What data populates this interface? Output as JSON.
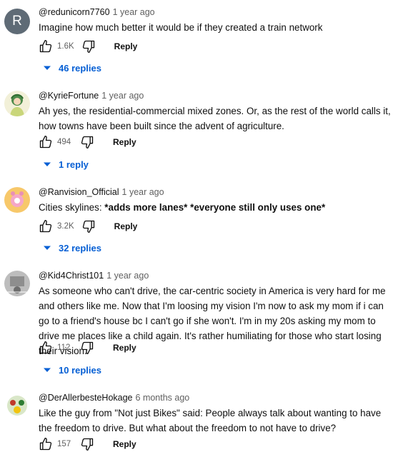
{
  "comments": [
    {
      "author": "@redunicorn7760",
      "time": "1 year ago",
      "avatar_letter": "R",
      "text": "Imagine how much better it would be if they created a train network",
      "likes": "1.6K",
      "reply_label": "Reply",
      "replies": "46 replies"
    },
    {
      "author": "@KyrieFortune",
      "time": "1 year ago",
      "text": "Ah yes, the residential-commercial mixed zones. Or, as the rest of the world calls it, how towns have been built since the advent of agriculture.",
      "likes": "494",
      "reply_label": "Reply",
      "replies": "1 reply"
    },
    {
      "author": "@Ranvision_Official",
      "time": "1 year ago",
      "text_parts": [
        "Cities skylines: ",
        "*adds more lanes*",
        " ",
        "*everyone still only uses one*"
      ],
      "likes": "3.2K",
      "reply_label": "Reply",
      "replies": "32 replies"
    },
    {
      "author": "@Kid4Christ101",
      "time": "1 year ago",
      "text": "As someone who can't drive, the car-centric society in America is very hard for me and others like me. Now that I'm loosing my vision I'm now to ask my mom if i can go to a friend's house bc I can't go if she won't. I'm in my 20s asking my mom to drive me places like a child again. It's rather humiliating for those who start losing their vision.",
      "likes": "112",
      "reply_label": "Reply",
      "replies": "10 replies"
    },
    {
      "author": "@DerAllerbesteHokage",
      "time": "6 months ago",
      "text": "Like the guy from \"Not just Bikes\" said: People always talk about wanting to have the freedom to drive. But what about the freedom to not have to drive?",
      "likes": "157",
      "reply_label": "Reply"
    }
  ],
  "colors": {
    "link": "#065fd4",
    "muted": "#606060",
    "text": "#0f0f0f",
    "avatar_r": "#5f6b76"
  },
  "icons": [
    "thumbs-up-icon",
    "thumbs-down-icon",
    "caret-down-icon"
  ]
}
